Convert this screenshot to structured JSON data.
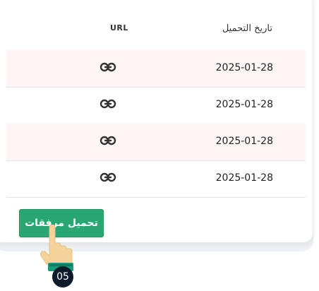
{
  "table": {
    "headers": {
      "url": "URL",
      "download_date": "تاريخ التحميل"
    },
    "rows": [
      {
        "url_icon": "link-icon",
        "date": "2025-01-28"
      },
      {
        "url_icon": "link-icon",
        "date": "2025-01-28"
      },
      {
        "url_icon": "link-icon",
        "date": "2025-01-28"
      },
      {
        "url_icon": "link-icon",
        "date": "2025-01-28"
      }
    ]
  },
  "actions": {
    "download_attachments_label": "تحميل مرفقات"
  },
  "tutorial": {
    "step_badge": "05",
    "pointer_icon": "hand-pointer-icon"
  },
  "colors": {
    "accent_green": "#28a773",
    "row_highlight": "#fdf6f5",
    "badge_dark": "#0e1b2c",
    "hand_skin": "#f3d39b"
  }
}
